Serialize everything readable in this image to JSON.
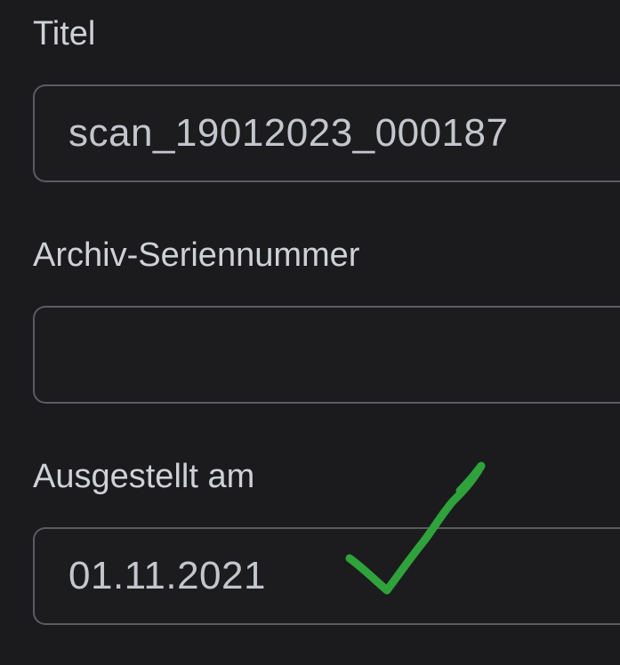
{
  "form": {
    "title": {
      "label": "Titel",
      "value": "scan_19012023_000187"
    },
    "archive_serial": {
      "label": "Archiv-Seriennummer",
      "value": ""
    },
    "issued_on": {
      "label": "Ausgestellt am",
      "value": "01.11.2021"
    }
  },
  "annotation": {
    "icon": "checkmark-icon",
    "color": "#2fa23c"
  }
}
